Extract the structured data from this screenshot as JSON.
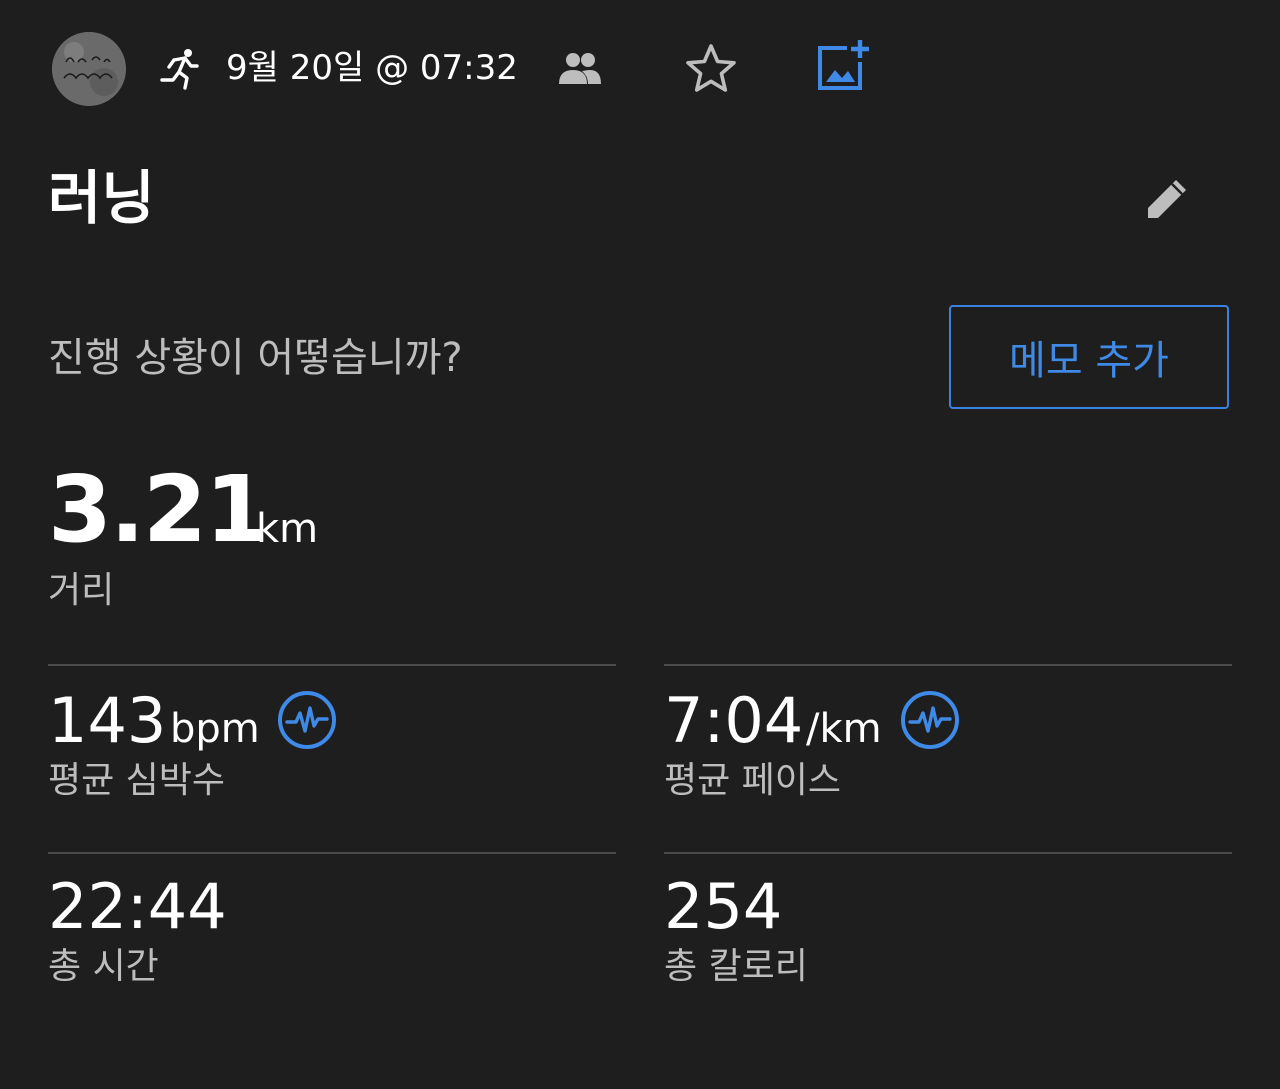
{
  "header": {
    "date_text": "9월 20일 @ 07:32",
    "icons": {
      "avatar": "profile-avatar",
      "activity": "running-icon",
      "privacy": "people-icon",
      "favorite": "star-outline-icon",
      "add_photo": "add-photo-icon"
    }
  },
  "activity": {
    "title": "러닝",
    "edit_icon": "pencil-icon"
  },
  "note": {
    "prompt": "진행 상황이 어떻습니까?",
    "add_memo_label": "메모 추가"
  },
  "distance": {
    "value": "3.21",
    "unit": "km",
    "label": "거리"
  },
  "stats": {
    "heart_rate": {
      "value": "143",
      "unit": "bpm",
      "label": "평균 심박수",
      "icon": "heart-rate-zone-icon"
    },
    "pace": {
      "value": "7:04",
      "unit": "/km",
      "label": "평균 페이스",
      "icon": "pace-zone-icon"
    },
    "total_time": {
      "value": "22:44",
      "label": "총 시간"
    },
    "calories": {
      "value": "254",
      "label": "총 칼로리"
    }
  },
  "colors": {
    "background": "#1e1e1e",
    "accent_blue": "#3f8ae6",
    "secondary_text": "#bdbdbd",
    "divider": "#4a4a4a"
  }
}
